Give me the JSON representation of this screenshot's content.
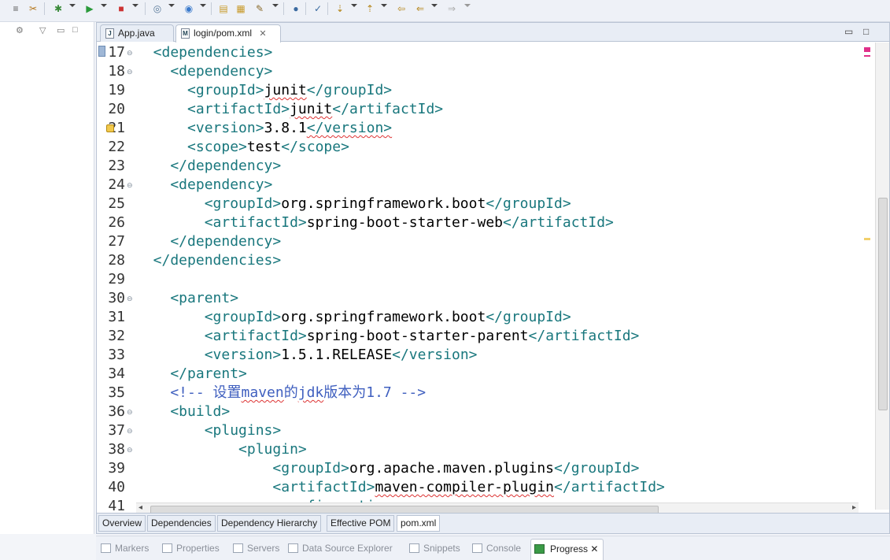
{
  "editor": {
    "tabs": [
      {
        "label": "App.java",
        "icon": "java-file-icon"
      },
      {
        "label": "login/pom.xml",
        "icon": "xml-file-icon",
        "close": "✕"
      }
    ]
  },
  "code_lines": [
    {
      "n": "17",
      "fold": "⊖",
      "tokens": [
        {
          "t": "  <dependencies>",
          "c": "tag"
        }
      ]
    },
    {
      "n": "18",
      "fold": "⊖",
      "tokens": [
        {
          "t": "    <dependency>",
          "c": "tag"
        }
      ]
    },
    {
      "n": "19",
      "tokens": [
        {
          "t": "      <groupId>",
          "c": "tag"
        },
        {
          "t": "junit",
          "c": "txt",
          "w": true
        },
        {
          "t": "</groupId>",
          "c": "tag"
        }
      ]
    },
    {
      "n": "20",
      "tokens": [
        {
          "t": "      <artifactId>",
          "c": "tag"
        },
        {
          "t": "junit",
          "c": "txt",
          "w": true
        },
        {
          "t": "</artifactId>",
          "c": "tag"
        }
      ]
    },
    {
      "n": "21",
      "warn": true,
      "tokens": [
        {
          "t": "      <version>",
          "c": "tag"
        },
        {
          "t": "3.8.1",
          "c": "txt"
        },
        {
          "t": "</version>",
          "c": "tag",
          "w": true
        }
      ]
    },
    {
      "n": "22",
      "tokens": [
        {
          "t": "      <scope>",
          "c": "tag"
        },
        {
          "t": "test",
          "c": "txt"
        },
        {
          "t": "</scope>",
          "c": "tag"
        }
      ]
    },
    {
      "n": "23",
      "tokens": [
        {
          "t": "    </dependency>",
          "c": "tag"
        }
      ]
    },
    {
      "n": "24",
      "fold": "⊖",
      "tokens": [
        {
          "t": "    <dependency>",
          "c": "tag"
        }
      ]
    },
    {
      "n": "25",
      "tokens": [
        {
          "t": "        <groupId>",
          "c": "tag"
        },
        {
          "t": "org.springframework.boot",
          "c": "txt"
        },
        {
          "t": "</groupId>",
          "c": "tag"
        }
      ]
    },
    {
      "n": "26",
      "tokens": [
        {
          "t": "        <artifactId>",
          "c": "tag"
        },
        {
          "t": "spring-boot-starter-web",
          "c": "txt"
        },
        {
          "t": "</artifactId>",
          "c": "tag"
        }
      ]
    },
    {
      "n": "27",
      "tokens": [
        {
          "t": "    </dependency>",
          "c": "tag"
        }
      ]
    },
    {
      "n": "28",
      "tokens": [
        {
          "t": "  </dependencies>",
          "c": "tag"
        }
      ]
    },
    {
      "n": "29",
      "tokens": []
    },
    {
      "n": "30",
      "fold": "⊖",
      "tokens": [
        {
          "t": "    <parent>",
          "c": "tag"
        }
      ]
    },
    {
      "n": "31",
      "tokens": [
        {
          "t": "        <groupId>",
          "c": "tag"
        },
        {
          "t": "org.springframework.boot",
          "c": "txt"
        },
        {
          "t": "</groupId>",
          "c": "tag"
        }
      ]
    },
    {
      "n": "32",
      "tokens": [
        {
          "t": "        <artifactId>",
          "c": "tag"
        },
        {
          "t": "spring-boot-starter-parent",
          "c": "txt"
        },
        {
          "t": "</artifactId>",
          "c": "tag"
        }
      ]
    },
    {
      "n": "33",
      "tokens": [
        {
          "t": "        <version>",
          "c": "tag"
        },
        {
          "t": "1.5.1.RELEASE",
          "c": "txt"
        },
        {
          "t": "</version>",
          "c": "tag"
        }
      ]
    },
    {
      "n": "34",
      "tokens": [
        {
          "t": "    </parent>",
          "c": "tag"
        }
      ]
    },
    {
      "n": "35",
      "tokens": [
        {
          "t": "    <!-- 设置",
          "c": "cmt"
        },
        {
          "t": "maven",
          "c": "cmt",
          "w": true
        },
        {
          "t": "的",
          "c": "cmt"
        },
        {
          "t": "jdk",
          "c": "cmt",
          "w": true
        },
        {
          "t": "版本为1.7 -->",
          "c": "cmt"
        }
      ]
    },
    {
      "n": "36",
      "fold": "⊖",
      "tokens": [
        {
          "t": "    <build>",
          "c": "tag"
        }
      ]
    },
    {
      "n": "37",
      "fold": "⊖",
      "tokens": [
        {
          "t": "        <plugins>",
          "c": "tag"
        }
      ]
    },
    {
      "n": "38",
      "fold": "⊖",
      "tokens": [
        {
          "t": "            <plugin>",
          "c": "tag"
        }
      ]
    },
    {
      "n": "39",
      "tokens": [
        {
          "t": "                <groupId>",
          "c": "tag"
        },
        {
          "t": "org.apache.maven.plugins",
          "c": "txt"
        },
        {
          "t": "</groupId>",
          "c": "tag"
        }
      ]
    },
    {
      "n": "40",
      "tokens": [
        {
          "t": "                <artifactId>",
          "c": "tag"
        },
        {
          "t": "maven-compiler-plugin",
          "c": "txt",
          "w": true
        },
        {
          "t": "</artifactId>",
          "c": "tag"
        }
      ]
    },
    {
      "n": "41",
      "tokens": [
        {
          "t": "                <configuration>",
          "c": "tag"
        }
      ]
    }
  ],
  "page_tabs": [
    "Overview",
    "Dependencies",
    "Dependency Hierarchy",
    "Effective POM",
    "pom.xml"
  ],
  "bottom_views": [
    {
      "label": "Markers",
      "icon": "markers-icon"
    },
    {
      "label": "Properties",
      "icon": "properties-icon"
    },
    {
      "label": "Servers",
      "icon": "servers-icon"
    },
    {
      "label": "Data Source Explorer",
      "icon": "data-source-icon"
    },
    {
      "label": "Snippets",
      "icon": "snippets-icon"
    },
    {
      "label": "Console",
      "icon": "console-icon"
    },
    {
      "label": "Progress",
      "icon": "progress-icon",
      "close": "✕"
    }
  ],
  "colors": {
    "tag": "#19777d",
    "comment": "#3f5fbf",
    "text": "#000000",
    "error_underline": "#d33333"
  }
}
